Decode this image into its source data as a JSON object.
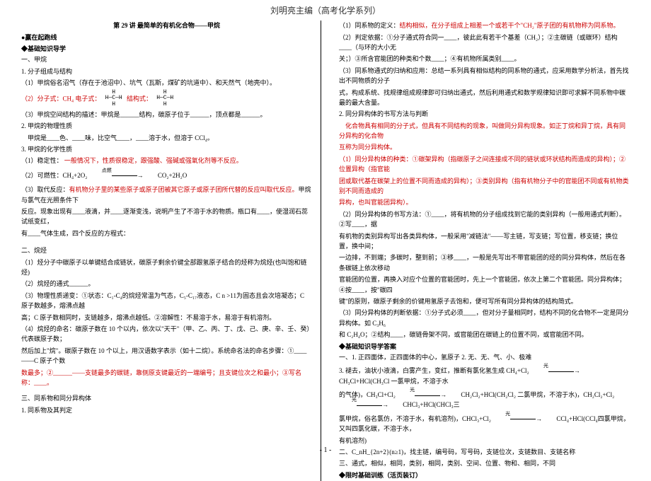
{
  "header": "刘明亮主编（高考化学系列）",
  "footer": "- 1 -",
  "left": {
    "lesson_title": "第 29 讲   最简单的有机化合物——甲烷",
    "sec_winline": "●赢在起跑线",
    "sec_basics": "◆基础知识导学",
    "h_methane": "一、甲烷",
    "l1": "1. 分子组成与结构",
    "l2": "（1）甲烷俗名沼气（存在于池沼中）、坑气（瓦斯，煤矿的坑道中）、和天然气（地壳中）。",
    "formula_label_a": "H",
    "formula_label_b": "H—C—H",
    "formula_label_c": "H",
    "l3a": "（2）分子式：",
    "l3b": "CH₄",
    "l3c": "  电子式：",
    "l3d": "   结构式：",
    "l4": "（3）甲烷空间结构的描述：甲烷是______结构，碳原子位于______，顶点都是______。",
    "l5": "2. 甲烷的物理性质",
    "l6": "甲烷是____色、____味，比空气____，____溶于水，但溶于 CCl₄。",
    "l7": "3. 甲烷的化学性质",
    "l7a": "（1）稳定性：",
    "l7b": "一般情况下，性质很稳定，跟强酸、强碱或强氧化剂等不反应。",
    "l8a": "（2）可燃性：CH₄+2O₂",
    "l8arrow": "点燃",
    "l8b": "CO₂+2H₂O",
    "l9a": "（3）取代反应：",
    "l9b": "有机物分子里的某些原子或原子团被其它原子或原子团所代替的反应叫取代反应。",
    "l9c": "甲烷与氯气在光照条件下",
    "l10": "反应。现象出现有____液滴，并____逐渐变浅，说明产生了不溶于水的物质。瓶口有____，使湿润石蕊试纸变红，",
    "l11": "有____气体生成，四个反应的方程式：",
    "h_alkane": "二、烷烃",
    "l12": "（1）烃分子中碳原子以单键结合成链状，碳原子剩余价键全部跟氢原子结合的烃称为烷烃(也叫饱和链烃)",
    "l13": "（2）烷烃的通式______。",
    "l14": "（3）物理性质递变：①状态：C₁-C₄的烷烃常温为气态，C₅-C₁₇液态，C n >11为固态且会次培凝态；C 原子数越多，熔沸点越",
    "l15": "高；C 原子数相同时，支链越多，熔沸点越低。②溶解性：不易溶于水，易溶于有机溶剂。",
    "l16": "（4）烷烃的命名：碳原子数在 10 个以内，依次以\"天干\"（甲、乙、丙、丁、戊、己、庚、辛、壬、癸）代表碳原子数；",
    "l17a": "然后加上\"烷\"。碳原子数在 10 个以上，用汉语数字表示（如十二烷）。系统命名法的命名步骤：①____——C 原子个数",
    "l17b": "数最多；②______——支链最多的碳链，靠侧原支键最近的一端编号；且支键位次之和最小；③写名称：____。",
    "h_isomer": "三、同系物和同分异构体",
    "l18": "1. 同系物及其判定"
  },
  "right": {
    "r1a": "（1）同系物的定义：",
    "r1b": "结构相似，在分子组成上相差一个或若干个\"CH₂\"原子团的有机物称为同系物。",
    "r2": "（2）判定依据：①分子通式符合同一____，彼此此有若干个基差（CH₂）；②主碳链（或碳环）结构____（与环的大小无",
    "r3": "关；）③所含官能团的种类和个数____；④有机物所属类别____。",
    "r4": "（3）同系物通式的归纳和应用：总结一系列具有相似结构的同系物的通式，应采用数学分析法，首先找出不同物质的分子",
    "r5": "式，构成系统、找规律组成规律即可归纳出通式，然后利用通式和数学规律知识即可求解不同系物中碳最的最大含量。",
    "r6": "2. 同分异构体的书写方法与判断",
    "r7": "化合物具有相同的分子式，但具有不同结构的现象，叫做同分异构现象。如正丁烷和异丁烷，具有同分异构的化合物",
    "r8": "互称为同分异构体。",
    "r9": "（1）同分异构体的种类：①碳架异构（指碳原子之间连接成不同的链状或环状结构而造成的异构）；②位置异构（指官能",
    "r10": "团或取代基在碳架上的位置不同而造成的异构）；③类别异构（指有机物分子中的官能团不同或有机物类别不同而造成的",
    "r11": "异构，也叫官能团异构）。",
    "r12": "（2）同分异构体的书写方法：①____，将有机物的分子组成找到它能的类别异构（一般用通式判断）。②写____，据",
    "r13": "有机物的类别异构写出各类异构体，一般采用\"减链法\"——写主链，写支链；写位置，移支链；换位置，换中间；",
    "r14": "一边排，不到端；多碳时，整到前；③移____，一般是先写出不带官能团的烃的同分异构体，然后在各条碳链上依次移动",
    "r15": "官能团的位置，再换入对应个位置的官能团时，先上一个官能团，依次上第二个官能团。同分异构体；④按____，按\"碳四",
    "r16": "键\"的原则，碳原子剩余的价键用氢原子去饱和，便可写所有同分异构体的结构简式。",
    "r17": "（3）同分异构体的判断依据：①分子式必须____，但对分子量相同时，结构不同的化合物不一定是同分异构体。如 C₃H₆",
    "r18": "和 C₂H₄O；②结构____，碳链骨架不同，或官能团在碳链上的位置不同，或官能团不同。",
    "sec_answers": "◆基础知识导学答案",
    "a1": "一、1. 正四面体，正四面体的中心，氢原子   2. 无、无、气、小、极难",
    "a2a": "3. 褪去，油状小液滴，白雾产生，变红，推断有氯化氢生成 CH₄+Cl₂",
    "a2arrow1": "光",
    "a2b": "CH₃Cl+HCl(CH₃Cl 一氯甲烷，不溶于水",
    "a3a": "的气体)，CH₃Cl+Cl₂",
    "a3arrow": "光",
    "a3b": "CH₂Cl₂+HCl(CH₂Cl₂ 二氯甲烷，不溶于水)，CH₂Cl₂+Cl₂",
    "a3arrow2": "光",
    "a3c": "CHCl₃+HCl(CHCl₃三",
    "a4a": "氯甲烷，俗名氯仿，不溶于水，有机溶剂)，CHCl₃+Cl₂",
    "a4arrow": "光",
    "a4b": "CCl₄+HCl(CCl₄四氯甲烷，又叫四氯化碳，不溶于水，",
    "a5": "有机溶剂)",
    "a6": "二、C_nH_{2n+2}(n≥1)，找主链，编号码，写号码，支链位次，支链数目、支链名称",
    "a7": "三、通式，相似，相同，类别，相同，类别、空间、位置、物和、相同，不同",
    "sec_timed": "◆限时基础训练（活页装订）"
  }
}
